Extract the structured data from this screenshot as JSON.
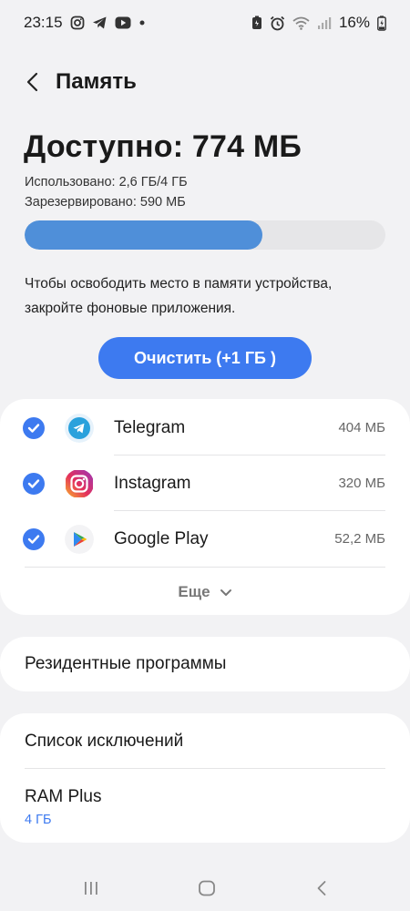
{
  "status_bar": {
    "time": "23:15",
    "notif_icons": [
      "instagram-icon",
      "telegram-icon",
      "youtube-icon",
      "dot-icon"
    ],
    "sys_icons": [
      "battery-saver-icon",
      "alarm-icon",
      "wifi-icon",
      "signal-icon"
    ],
    "battery": "16%"
  },
  "header": {
    "title": "Память"
  },
  "memory": {
    "available": "Доступно: 774 МБ",
    "used": "Использовано: 2,6 ГБ/4 ГБ",
    "reserved": "Зарезервировано: 590 МБ",
    "usage_fraction": 0.66
  },
  "hint": "Чтобы освободить место в памяти устройства, закройте фоновые приложения.",
  "clean_button": "Очистить (+1 ГБ )",
  "apps": [
    {
      "name": "Telegram",
      "size": "404 МБ",
      "checked": true,
      "icon": "telegram-icon"
    },
    {
      "name": "Instagram",
      "size": "320 МБ",
      "checked": true,
      "icon": "instagram-icon"
    },
    {
      "name": "Google Play",
      "size": "52,2 МБ",
      "checked": true,
      "icon": "google-play-icon"
    }
  ],
  "more_label": "Еще",
  "resident_programs": "Резидентные программы",
  "exceptions": "Список исключений",
  "ram_plus": {
    "label": "RAM Plus",
    "value": "4 ГБ"
  },
  "colors": {
    "accent": "#3d7af0",
    "bar": "#4f8fd9",
    "background": "#f2f2f4"
  }
}
